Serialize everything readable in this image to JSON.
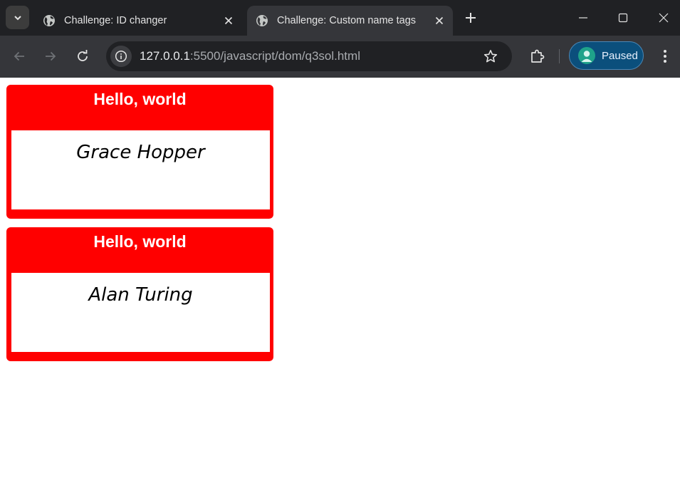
{
  "browser": {
    "tabs": [
      {
        "title": "Challenge: ID changer",
        "active": false,
        "icon": "globe-icon"
      },
      {
        "title": "Challenge: Custom name tags",
        "active": true,
        "icon": "globe-icon"
      }
    ],
    "address_bar": {
      "host": "127.0.0.1",
      "rest": ":5500/javascript/dom/q3sol.html"
    },
    "profile": {
      "label": "Paused"
    },
    "colors": {
      "tabstrip": "#202124",
      "toolbar": "#35363a",
      "profile_bg": "#0b4f7c"
    }
  },
  "page": {
    "name_tags": [
      {
        "greeting": "Hello, world",
        "name": "Grace Hopper"
      },
      {
        "greeting": "Hello, world",
        "name": "Alan Turing"
      }
    ],
    "colors": {
      "tag_red": "#ff0000",
      "name_box": "#ffffff"
    }
  }
}
